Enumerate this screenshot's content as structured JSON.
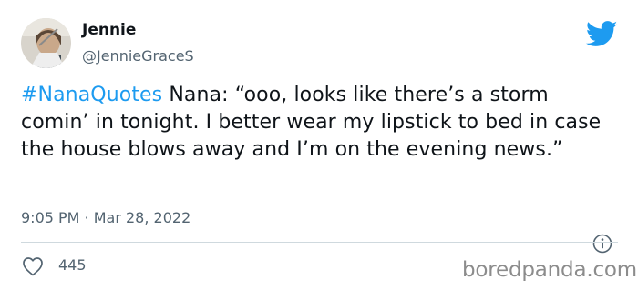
{
  "tweet": {
    "author": {
      "name": "Jennie",
      "handle": "@JennieGraceS"
    },
    "hashtag": "#NanaQuotes",
    "body": " Nana: “ooo, looks like there’s a storm comin’ in tonight. I better wear my lipstick to bed in case the house blows away and I’m on the evening news.”",
    "timestamp": "9:05 PM · Mar 28, 2022",
    "likes": "445"
  },
  "icons": {
    "brand": "twitter-bird-icon",
    "info": "info-icon",
    "like": "heart-icon"
  },
  "colors": {
    "twitter_blue": "#1d9bf0",
    "text_primary": "#0f1419",
    "text_secondary": "#536471",
    "divider": "#cfd9de"
  },
  "watermark": "boredpanda.com"
}
